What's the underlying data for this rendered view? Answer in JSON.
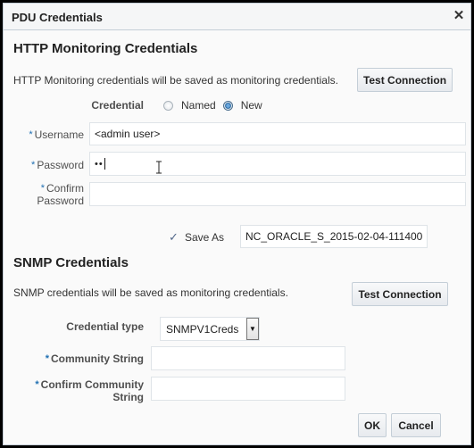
{
  "dialog": {
    "title": "PDU Credentials",
    "close_icon": "close-icon"
  },
  "http": {
    "section_title": "HTTP Monitoring Credentials",
    "description": "HTTP Monitoring credentials will be saved as monitoring credentials.",
    "test_connection_label": "Test Connection",
    "credential_label": "Credential",
    "credential_options": [
      {
        "label": "Named",
        "checked": false
      },
      {
        "label": "New",
        "checked": true
      }
    ],
    "required_marker": "*",
    "username_label": "Username",
    "username_value": "<admin user>",
    "password_label": "Password",
    "password_value": "••",
    "confirm_password_label_line1": "Confirm",
    "confirm_password_label_line2": "Password",
    "confirm_password_value": "",
    "save_as_check": "✓",
    "save_as_label": "Save As",
    "save_as_value": "NC_ORACLE_S_2015-02-04-111400"
  },
  "snmp": {
    "section_title": "SNMP Credentials",
    "description": "SNMP credentials will be saved as monitoring credentials.",
    "test_connection_label": "Test Connection",
    "credential_type_label": "Credential type",
    "credential_type_value": "SNMPV1Creds",
    "required_marker": "*",
    "community_string_label": "Community String",
    "community_string_value": "",
    "confirm_community_label_line1": "Confirm Community",
    "confirm_community_label_line2": "String",
    "confirm_community_value": ""
  },
  "footer": {
    "ok_label": "OK",
    "cancel_label": "Cancel"
  },
  "colors": {
    "required_marker": "#1f6fb2",
    "radio_selected": "#1b5e9a"
  }
}
